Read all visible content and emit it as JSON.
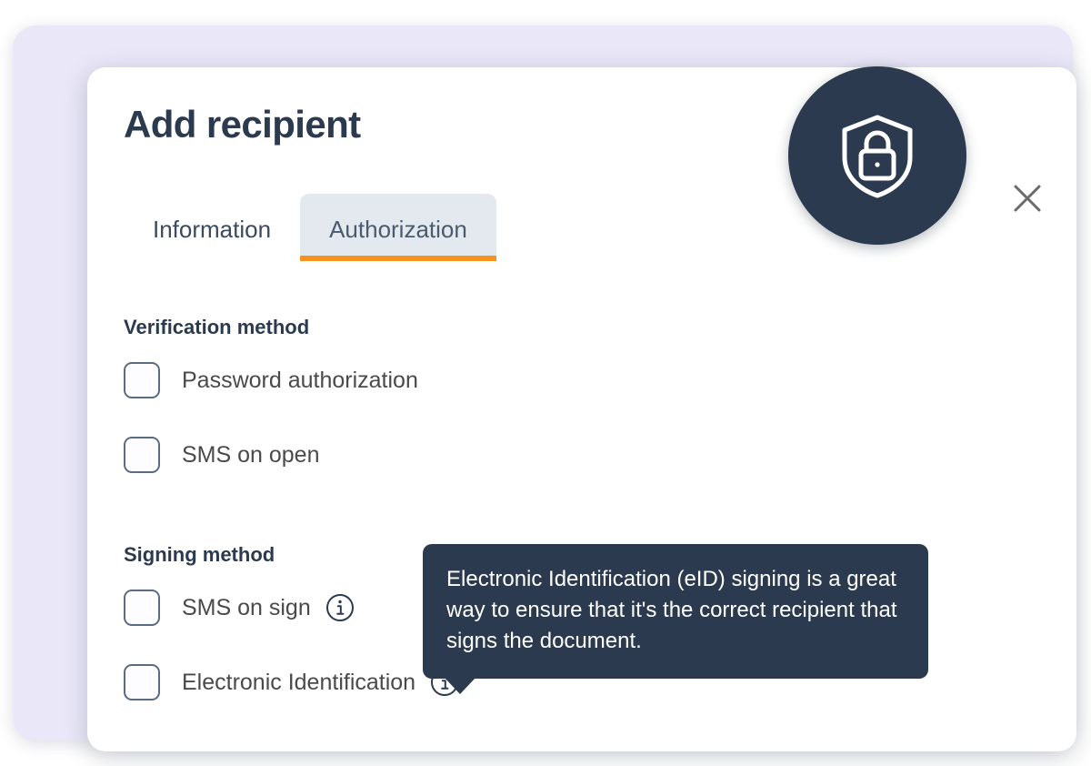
{
  "theme": {
    "outer_background": "#ffffff",
    "panel_background": "#e9e7f8",
    "card_background": "#ffffff",
    "dark_navy": "#2b3a4e",
    "accent_orange": "#f59220",
    "active_tab_background": "#e4e9ef",
    "checkbox_border": "#5a6b82",
    "body_text": "#4a4a4a",
    "close_icon_color": "#6b6b6b"
  },
  "modal": {
    "title": "Add recipient",
    "badge_icon": "shield-lock-icon",
    "close_icon": "close-icon",
    "tabs": [
      {
        "label": "Information",
        "active": false
      },
      {
        "label": "Authorization",
        "active": true
      }
    ],
    "sections": [
      {
        "id": "verification",
        "heading": "Verification method",
        "options": [
          {
            "label": "Password authorization",
            "checked": false,
            "has_info": false
          },
          {
            "label": "SMS on open",
            "checked": false,
            "has_info": false
          }
        ]
      },
      {
        "id": "signing",
        "heading": "Signing method",
        "options": [
          {
            "label": "SMS on sign",
            "checked": false,
            "has_info": true,
            "info_icon": "info-icon"
          },
          {
            "label": "Electronic Identification",
            "checked": false,
            "has_info": true,
            "info_icon": "info-icon"
          }
        ]
      }
    ],
    "tooltip": {
      "text": "Electronic Identification (eID) signing is a great way to ensure that it's the correct recipient that signs the document.",
      "anchor": "Electronic Identification"
    }
  }
}
